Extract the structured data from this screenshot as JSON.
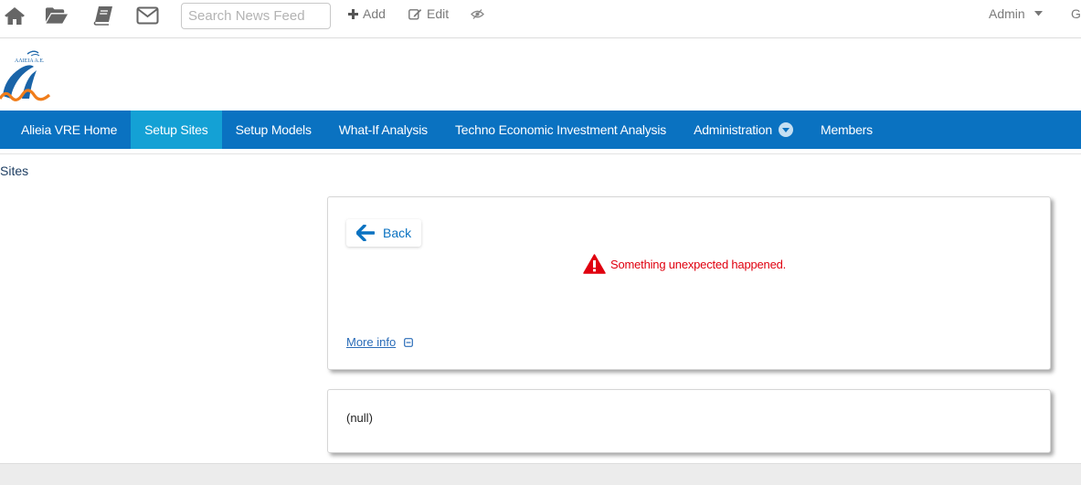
{
  "toolbar": {
    "icons": [
      "home-icon",
      "folder-open-icon",
      "book-icon",
      "envelope-icon"
    ],
    "search_placeholder": "Search News Feed",
    "add_label": "Add",
    "edit_label": "Edit",
    "admin_label": "Admin",
    "cut_label": "G"
  },
  "logo": {
    "text": "ΑΛΙΕΙΑ Α.Ε."
  },
  "nav": {
    "items": [
      {
        "label": "Alieia VRE Home"
      },
      {
        "label": "Setup Sites",
        "active": true
      },
      {
        "label": "Setup Models"
      },
      {
        "label": "What-If Analysis"
      },
      {
        "label": "Techno Economic Investment Analysis"
      },
      {
        "label": "Administration",
        "has_dropdown": true
      },
      {
        "label": "Members"
      }
    ],
    "colors": {
      "bar": "#0a72c1",
      "active": "#14a1d5"
    }
  },
  "breadcrumb": {
    "title": "Sites"
  },
  "error_panel": {
    "back_label": "Back",
    "message": "Something unexpected happened.",
    "more_info_label": "More info",
    "error_color": "#e0000f"
  },
  "null_panel": {
    "text": "(null)"
  }
}
